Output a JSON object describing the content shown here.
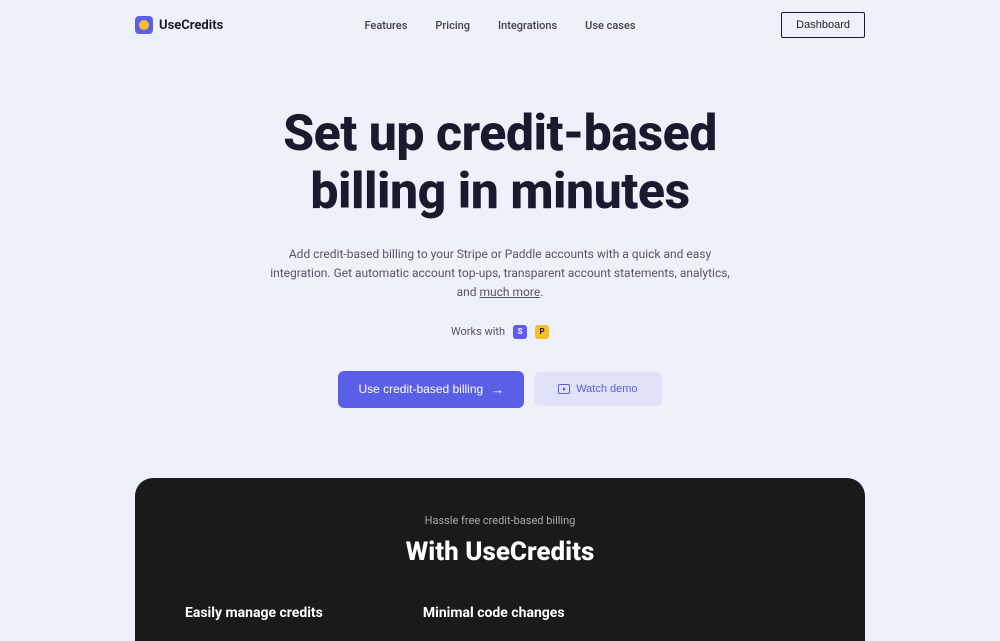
{
  "header": {
    "logo_text": "UseCredits",
    "nav": {
      "features": "Features",
      "pricing": "Pricing",
      "integrations": "Integrations",
      "use_cases": "Use cases"
    },
    "dashboard_btn": "Dashboard"
  },
  "hero": {
    "title_line1": "Set up credit-based",
    "title_line2": "billing in minutes",
    "subtitle_pre": "Add credit-based billing to your Stripe or Paddle accounts with a quick and easy integration. Get automatic account top-ups, transparent account statements, analytics, and ",
    "subtitle_link": "much more",
    "subtitle_post": ".",
    "works_with": "Works with",
    "provider_stripe": "S",
    "provider_paddle": "P",
    "cta_primary": "Use credit-based billing",
    "cta_secondary": "Watch demo"
  },
  "dark_section": {
    "subtitle": "Hassle free credit-based billing",
    "title": "With UseCredits",
    "features": {
      "f1": "Easily manage credits",
      "f2": "Minimal code changes"
    }
  }
}
